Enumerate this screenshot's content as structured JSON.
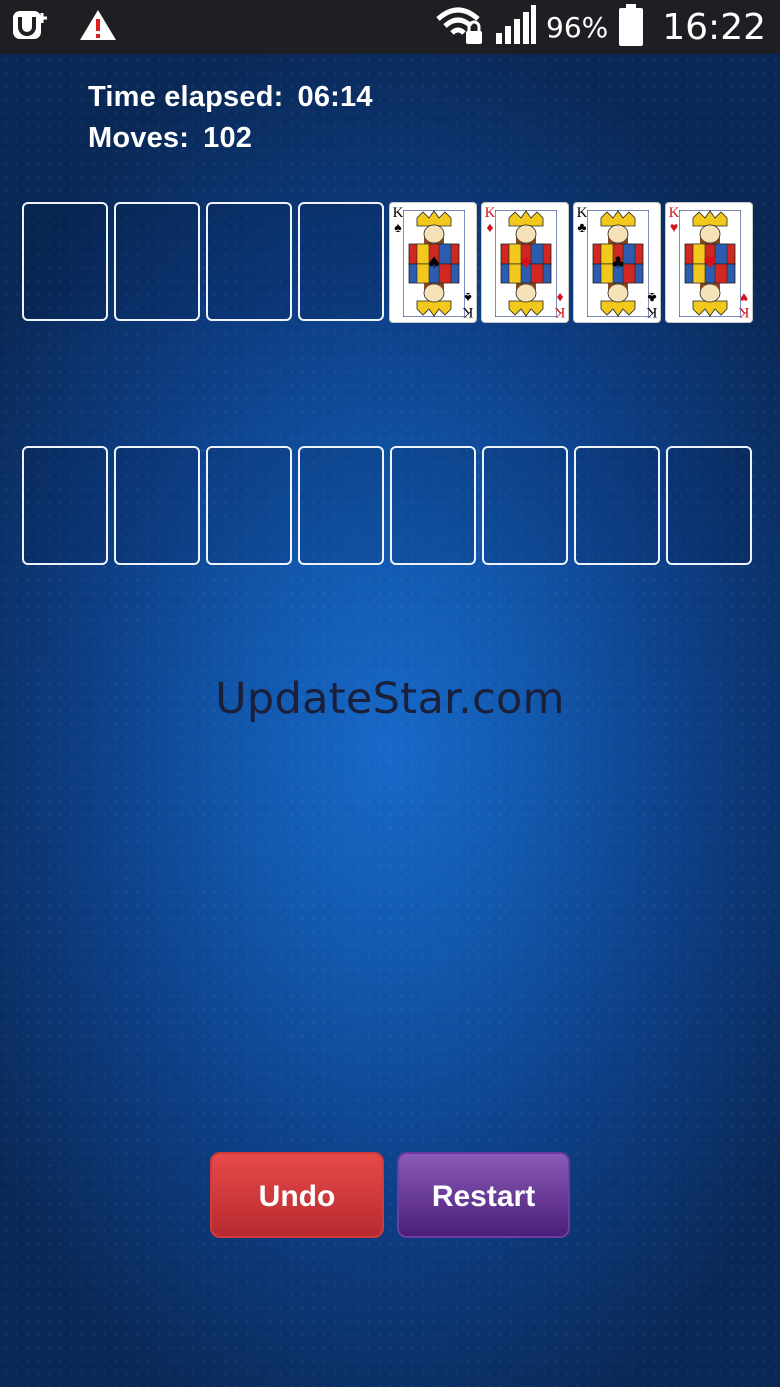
{
  "status_bar": {
    "left_icons": [
      "app-u-icon",
      "warning-icon"
    ],
    "right_icons": [
      "wifi-lock-icon",
      "signal-icon",
      "battery-icon"
    ],
    "battery_percent": "96%",
    "time": "16:22"
  },
  "game": {
    "time_label": "Time elapsed:",
    "time_value": "06:14",
    "moves_label": "Moves:",
    "moves_value": "102",
    "free_cells": 4,
    "foundations": [
      {
        "rank": "K",
        "suit": "♠",
        "color": "#000000"
      },
      {
        "rank": "K",
        "suit": "♦",
        "color": "#d5121b"
      },
      {
        "rank": "K",
        "suit": "♣",
        "color": "#000000"
      },
      {
        "rank": "K",
        "suit": "♥",
        "color": "#d5121b"
      }
    ],
    "tableau_columns": 8,
    "watermark": "UpdateStar.com"
  },
  "buttons": {
    "undo": "Undo",
    "restart": "Restart"
  },
  "colors": {
    "table_center": "#1769c9",
    "table_edge": "#0a2856",
    "undo": "#d63b3e",
    "restart": "#6a3a9a"
  }
}
